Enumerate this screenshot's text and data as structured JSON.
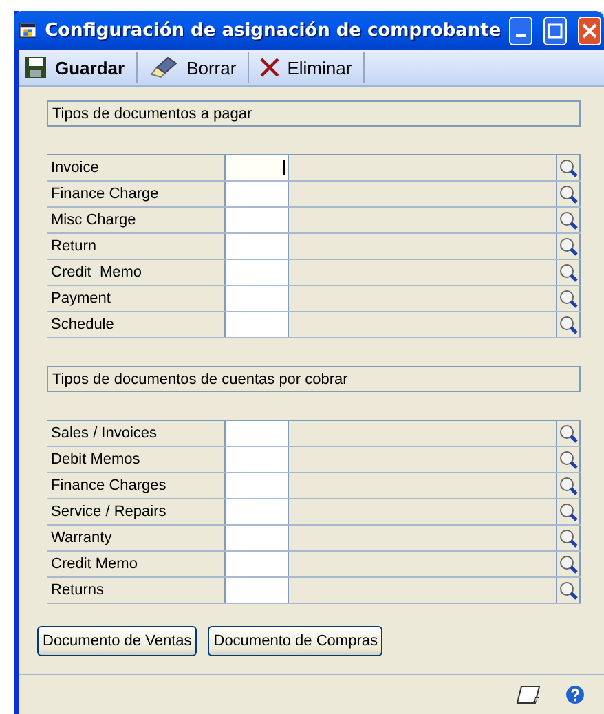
{
  "window": {
    "title": "Configuración de asignación de comprobante"
  },
  "toolbar": [
    {
      "kind": "save",
      "label": "Guardar"
    },
    {
      "kind": "clear",
      "label": "Borrar"
    },
    {
      "kind": "delete",
      "label": "Eliminar"
    }
  ],
  "sections": [
    {
      "title": "Tipos de documentos a pagar",
      "rows": [
        {
          "label": "Invoice",
          "focused": true
        },
        {
          "label": "Finance Charge",
          "focused": false
        },
        {
          "label": "Misc Charge",
          "focused": false
        },
        {
          "label": "Return",
          "focused": false
        },
        {
          "label": "Credit  Memo",
          "focused": false
        },
        {
          "label": "Payment",
          "focused": false
        },
        {
          "label": "Schedule",
          "focused": false
        }
      ]
    },
    {
      "title": "Tipos de documentos de cuentas por cobrar",
      "rows": [
        {
          "label": "Sales / Invoices",
          "focused": false
        },
        {
          "label": "Debit Memos",
          "focused": false
        },
        {
          "label": "Finance Charges",
          "focused": false
        },
        {
          "label": "Service / Repairs",
          "focused": false
        },
        {
          "label": "Warranty",
          "focused": false
        },
        {
          "label": "Credit Memo",
          "focused": false
        },
        {
          "label": "Returns",
          "focused": false
        }
      ]
    }
  ],
  "buttons": [
    "Documento de Ventas",
    "Documento de Compras"
  ]
}
